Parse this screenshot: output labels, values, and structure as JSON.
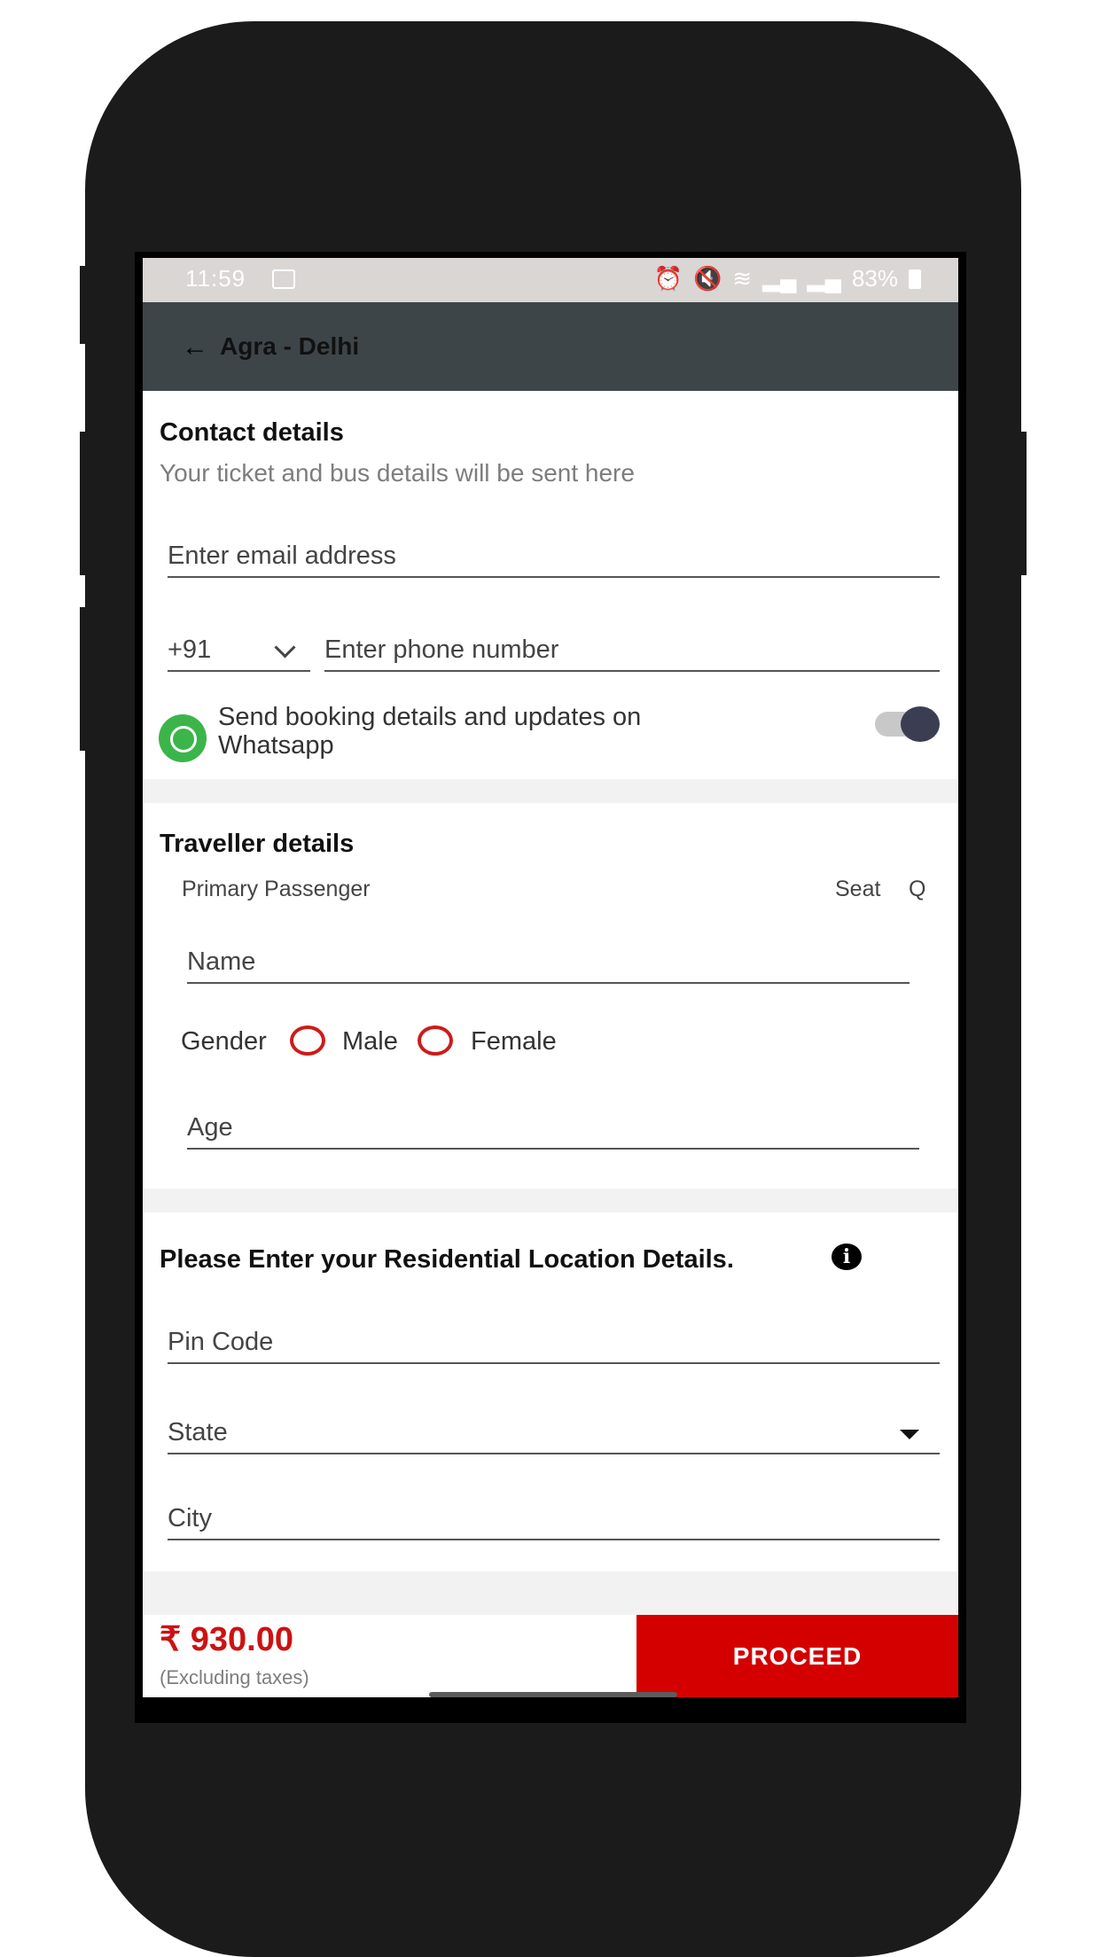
{
  "status_bar": {
    "time": "11:59",
    "battery": "83%",
    "icons": [
      "image-icon",
      "alarm-icon",
      "mute-icon",
      "wifi-icon",
      "volte-icon",
      "signal-icon",
      "signal-icon",
      "battery-icon"
    ]
  },
  "app_bar": {
    "back_icon": "arrow-left-icon",
    "title": "Agra - Delhi"
  },
  "contact": {
    "heading": "Contact details",
    "subheading": "Your ticket and bus details will be sent here",
    "email_placeholder": "Enter email address",
    "country_code": "+91",
    "phone_placeholder": "Enter phone number",
    "whatsapp_label": "Send booking details and updates on Whatsapp",
    "whatsapp_enabled": true
  },
  "traveller": {
    "heading": "Traveller details",
    "passenger_label": "Primary Passenger",
    "seat_label": "Seat",
    "seat_value": "Q",
    "name_placeholder": "Name",
    "gender_label": "Gender",
    "gender_options": [
      "Male",
      "Female"
    ],
    "age_placeholder": "Age"
  },
  "residential": {
    "heading": "Please Enter your Residential Location Details.",
    "pin_placeholder": "Pin Code",
    "state_placeholder": "State",
    "city_placeholder": "City"
  },
  "footer": {
    "price": "₹ 930.00",
    "price_note": "(Excluding taxes)",
    "proceed_label": "PROCEED"
  },
  "colors": {
    "app_bar": "#3e4549",
    "accent_red": "#d40000",
    "whatsapp_green": "#3bb54a"
  }
}
